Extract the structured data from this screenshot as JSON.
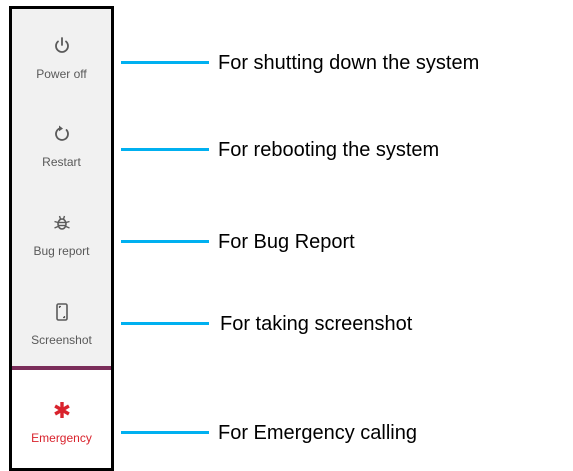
{
  "menu": {
    "items": [
      {
        "label": "Power off",
        "icon": "power-icon"
      },
      {
        "label": "Restart",
        "icon": "restart-icon"
      },
      {
        "label": "Bug report",
        "icon": "bug-icon"
      },
      {
        "label": "Screenshot",
        "icon": "screenshot-icon"
      }
    ],
    "emergency": {
      "label": "Emergency",
      "icon": "asterisk-icon"
    }
  },
  "callouts": [
    "For shutting down the system",
    "For rebooting the system",
    "For Bug Report",
    "For taking screenshot",
    "For Emergency calling"
  ],
  "colors": {
    "connector": "#00b0f0",
    "divider": "#7b2d5a",
    "emergency": "#d9232d",
    "panel": "#f1f1f1"
  }
}
